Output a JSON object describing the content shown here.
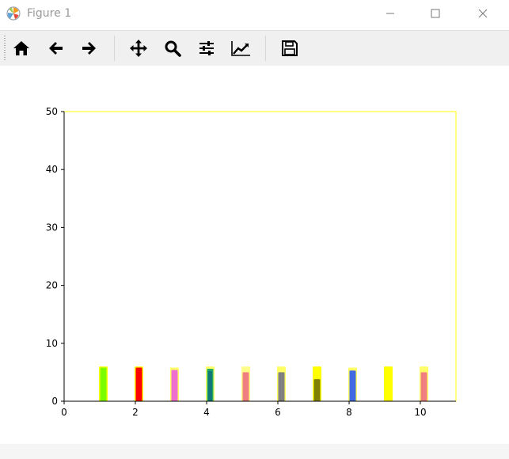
{
  "window": {
    "title": "Figure 1",
    "icon": "matplotlib-logo-icon",
    "controls": [
      "minimize-icon",
      "maximize-icon",
      "close-icon"
    ]
  },
  "toolbar": {
    "buttons": [
      {
        "name": "home-button",
        "icon": "home-icon"
      },
      {
        "name": "back-button",
        "icon": "arrow-left-icon"
      },
      {
        "name": "forward-button",
        "icon": "arrow-right-icon"
      },
      {
        "name": "pan-button",
        "icon": "move-icon"
      },
      {
        "name": "zoom-button",
        "icon": "search-icon"
      },
      {
        "name": "subplots-button",
        "icon": "sliders-icon"
      },
      {
        "name": "edit-axes-button",
        "icon": "line-chart-icon"
      },
      {
        "name": "save-button",
        "icon": "floppy-disk-icon"
      }
    ]
  },
  "chart_data": {
    "type": "bar",
    "xlim": [
      0,
      11
    ],
    "ylim": [
      0,
      50
    ],
    "xticks": [
      "0",
      "2",
      "4",
      "6",
      "8",
      "10"
    ],
    "yticks": [
      "0",
      "10",
      "20",
      "30",
      "40",
      "50"
    ],
    "frame_color": "#ffff00",
    "bars": [
      {
        "x": 1.1,
        "value": 6,
        "color": "#ffff00"
      },
      {
        "x": 1.1,
        "value": 5.8,
        "color": "#7cfc00"
      },
      {
        "x": 2.1,
        "value": 6,
        "color": "#ffff00"
      },
      {
        "x": 2.1,
        "value": 5.8,
        "color": "#ff0000"
      },
      {
        "x": 3.1,
        "value": 5.8,
        "color": "#ffff66"
      },
      {
        "x": 3.1,
        "value": 5.4,
        "color": "#ee6fce"
      },
      {
        "x": 4.1,
        "value": 6,
        "color": "#ffff66"
      },
      {
        "x": 4.1,
        "value": 5.6,
        "color": "#22aa66"
      },
      {
        "x": 4.1,
        "value": 5.2,
        "color": "#117777"
      },
      {
        "x": 5.1,
        "value": 6,
        "color": "#ffff88"
      },
      {
        "x": 5.1,
        "value": 5,
        "color": "#f08080"
      },
      {
        "x": 6.1,
        "value": 6,
        "color": "#ffff66"
      },
      {
        "x": 6.1,
        "value": 5,
        "color": "#808080"
      },
      {
        "x": 7.1,
        "value": 6,
        "color": "#ffff00"
      },
      {
        "x": 7.1,
        "value": 3.8,
        "color": "#808000"
      },
      {
        "x": 8.1,
        "value": 5.8,
        "color": "#ffff66"
      },
      {
        "x": 8.1,
        "value": 5.3,
        "color": "#4169e1"
      },
      {
        "x": 9.1,
        "value": 6,
        "color": "#ffff00"
      },
      {
        "x": 10.1,
        "value": 6,
        "color": "#ffff66"
      },
      {
        "x": 10.1,
        "value": 5,
        "color": "#f08080"
      }
    ]
  }
}
